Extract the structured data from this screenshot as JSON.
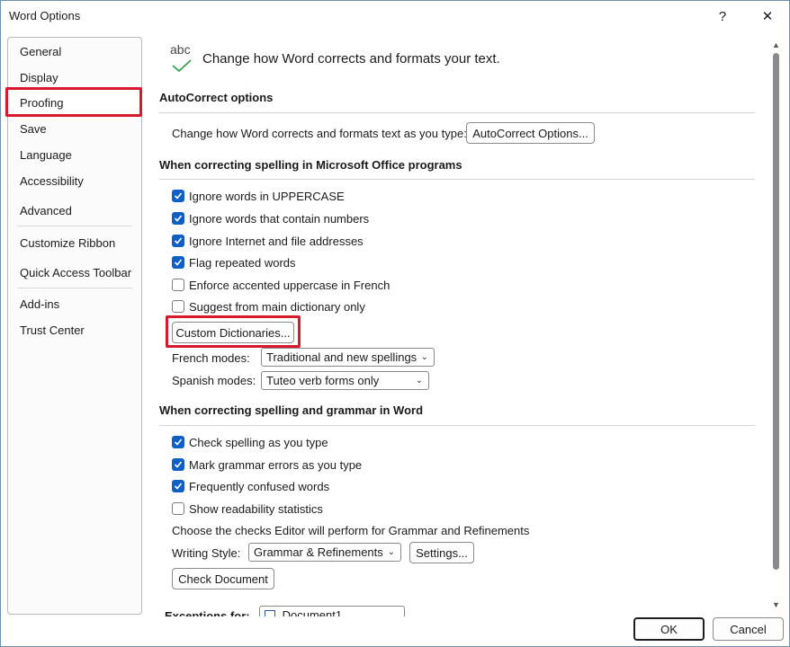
{
  "window": {
    "title": "Word Options",
    "help_label": "?",
    "close_label": "✕"
  },
  "nav": {
    "items": [
      {
        "label": "General"
      },
      {
        "label": "Display"
      },
      {
        "label": "Proofing"
      },
      {
        "label": "Save"
      },
      {
        "label": "Language"
      },
      {
        "label": "Accessibility"
      },
      {
        "label": "Advanced"
      },
      {
        "label": "Customize Ribbon"
      },
      {
        "label": "Quick Access Toolbar"
      },
      {
        "label": "Add-ins"
      },
      {
        "label": "Trust Center"
      }
    ],
    "selected": "Proofing"
  },
  "header": {
    "icon_text": "abc",
    "text": "Change how Word corrects and formats your text."
  },
  "autocorrect": {
    "title": "AutoCorrect options",
    "description": "Change how Word corrects and formats text as you type:",
    "button_label": "AutoCorrect Options..."
  },
  "office_spelling": {
    "title": "When correcting spelling in Microsoft Office programs",
    "checks": [
      {
        "label": "Ignore words in UPPERCASE",
        "checked": true
      },
      {
        "label": "Ignore words that contain numbers",
        "checked": true
      },
      {
        "label": "Ignore Internet and file addresses",
        "checked": true
      },
      {
        "label": "Flag repeated words",
        "checked": true
      },
      {
        "label": "Enforce accented uppercase in French",
        "checked": false
      },
      {
        "label": "Suggest from main dictionary only",
        "checked": false
      }
    ],
    "custom_dictionaries_label": "Custom Dictionaries...",
    "french_modes": {
      "label": "French modes:",
      "value": "Traditional and new spellings"
    },
    "spanish_modes": {
      "label": "Spanish modes:",
      "value": "Tuteo verb forms only"
    }
  },
  "word_spelling": {
    "title": "When correcting spelling and grammar in Word",
    "checks": [
      {
        "label": "Check spelling as you type",
        "checked": true
      },
      {
        "label": "Mark grammar errors as you type",
        "checked": true
      },
      {
        "label": "Frequently confused words",
        "checked": true
      },
      {
        "label": "Show readability statistics",
        "checked": false
      }
    ],
    "editor_text": "Choose the checks Editor will perform for Grammar and Refinements",
    "writing_style": {
      "label": "Writing Style:",
      "value": "Grammar & Refinements"
    },
    "settings_label": "Settings...",
    "check_document_label": "Check Document",
    "exceptions_label": "Exceptions for:",
    "exceptions_value": "Document1"
  },
  "footer": {
    "ok_label": "OK",
    "cancel_label": "Cancel"
  },
  "colors": {
    "accent": "#0f5fc4",
    "highlight": "#d8192b"
  },
  "icons": [
    "question-icon",
    "close-icon",
    "abc-check-icon",
    "checkmark-icon",
    "chevron-down-icon",
    "document-icon",
    "scroll-up-icon",
    "scroll-down-icon"
  ]
}
